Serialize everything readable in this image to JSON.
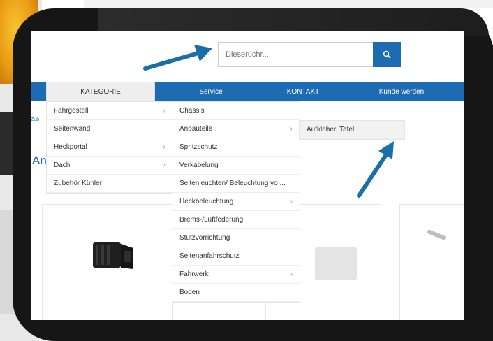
{
  "search": {
    "placeholder": "Dieserüchr..."
  },
  "nav": {
    "items": [
      "KATEGORIE",
      "Service",
      "KONTAKT",
      "Kunde werden"
    ]
  },
  "menu_level1": [
    {
      "label": "Fahrgestell",
      "has_submenu": true
    },
    {
      "label": "Seitenwand",
      "has_submenu": false
    },
    {
      "label": "Heckportal",
      "has_submenu": true
    },
    {
      "label": "Dach",
      "has_submenu": true
    },
    {
      "label": "Zubehör Kühler",
      "has_submenu": false
    }
  ],
  "menu_level2": [
    {
      "label": "Chassis",
      "has_submenu": false
    },
    {
      "label": "Anbauteile",
      "has_submenu": true
    },
    {
      "label": "Spritzschutz",
      "has_submenu": false
    },
    {
      "label": "Verkabelung",
      "has_submenu": false
    },
    {
      "label": "Seitenleuchten/ Beleuchtung vo ...",
      "has_submenu": false
    },
    {
      "label": "Heckbeleuchtung",
      "has_submenu": true
    },
    {
      "label": "Brems-/Luftfederung",
      "has_submenu": false
    },
    {
      "label": "Stützvorrichtung",
      "has_submenu": false
    },
    {
      "label": "Seitenanfahrschutz",
      "has_submenu": false
    },
    {
      "label": "Fahrwerk",
      "has_submenu": true
    },
    {
      "label": "Boden",
      "has_submenu": false
    }
  ],
  "menu_level3": [
    {
      "label": "Aufkleber, Tafel"
    }
  ],
  "page": {
    "peek_link": "Zub",
    "peek_heading": "An"
  },
  "icons": {
    "search": "search-icon",
    "chevron": "chevron-right-icon",
    "annotation_arrow": "arrow-icon"
  },
  "colors": {
    "brand_blue": "#1d6bb3",
    "arrow_blue": "#1a6fa8",
    "frame": "#161616"
  }
}
